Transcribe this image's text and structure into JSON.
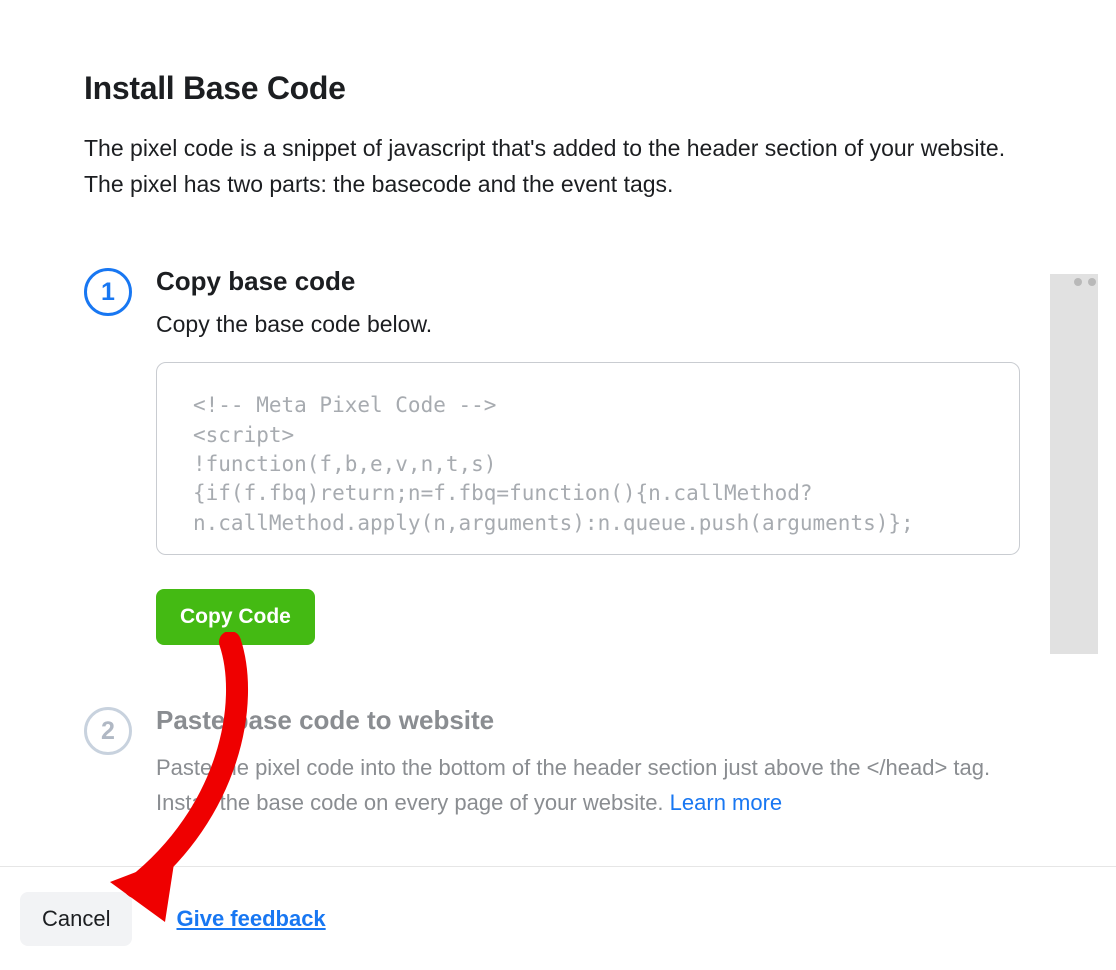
{
  "header": {
    "title": "Install Base Code",
    "description": "The pixel code is a snippet of javascript that's added to the header section of your website. The pixel has two parts: the basecode and the event tags."
  },
  "step1": {
    "number": "1",
    "title": "Copy base code",
    "subtitle": "Copy the base code below.",
    "code": "<!-- Meta Pixel Code -->\n<script>\n!function(f,b,e,v,n,t,s)\n{if(f.fbq)return;n=f.fbq=function(){n.callMethod?\nn.callMethod.apply(n,arguments):n.queue.push(arguments)};",
    "copy_button": "Copy Code"
  },
  "step2": {
    "number": "2",
    "title": "Paste base code to website",
    "desc_before": "Paste the pixel code into the bottom of the header section just above the </head> tag. Install the base code on every page of your website. ",
    "learn_more": "Learn more"
  },
  "footer": {
    "cancel": "Cancel",
    "feedback": "Give feedback"
  }
}
